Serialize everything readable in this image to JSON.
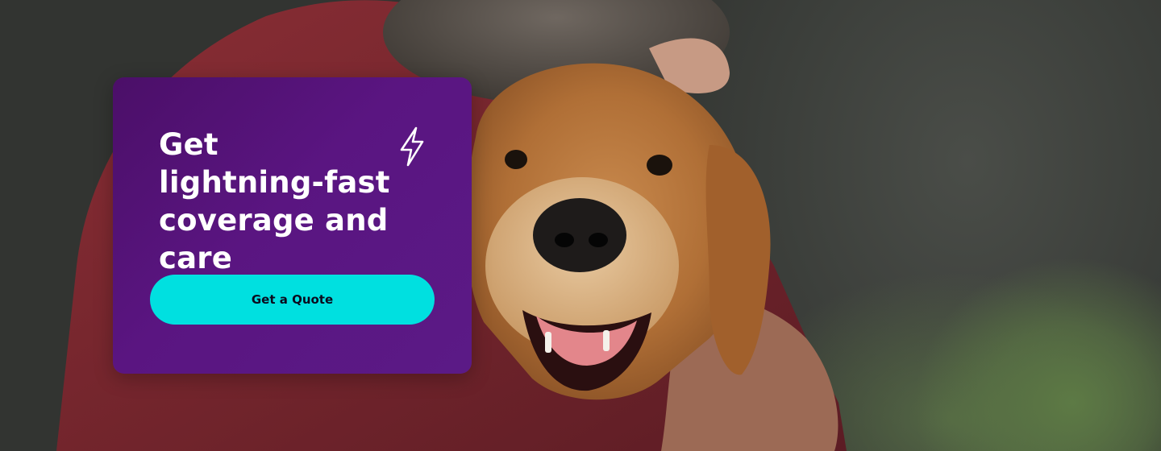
{
  "hero": {
    "headline": "Get lightning-fast coverage and care",
    "icon": "lightning-bolt-icon",
    "cta_label": "Get a Quote",
    "colors": {
      "card": "#561580",
      "cta": "#00e0e0",
      "headline_text": "#ffffff",
      "cta_text": "#0b0b1e"
    }
  }
}
